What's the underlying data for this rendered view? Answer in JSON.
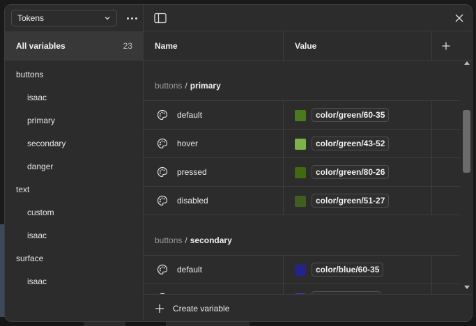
{
  "collection_select": {
    "value": "Tokens"
  },
  "sidebar": {
    "all_variables_label": "All variables",
    "all_variables_count": "23",
    "groups": [
      {
        "label": "buttons",
        "level": 0
      },
      {
        "label": "isaac",
        "level": 1
      },
      {
        "label": "primary",
        "level": 1
      },
      {
        "label": "secondary",
        "level": 1
      },
      {
        "label": "danger",
        "level": 1
      },
      {
        "label": "text",
        "level": 0
      },
      {
        "label": "custom",
        "level": 1
      },
      {
        "label": "isaac",
        "level": 1
      },
      {
        "label": "surface",
        "level": 0
      },
      {
        "label": "isaac",
        "level": 1
      }
    ]
  },
  "table": {
    "col_name": "Name",
    "col_value": "Value",
    "sections": [
      {
        "prefix": "buttons",
        "sep": "/",
        "name": "primary",
        "rows": [
          {
            "name": "default",
            "alias": "color/green/60-35",
            "swatch": "#4a7a1e"
          },
          {
            "name": "hover",
            "alias": "color/green/43-52",
            "swatch": "#7db24a"
          },
          {
            "name": "pressed",
            "alias": "color/green/80-26",
            "swatch": "#3f6a12"
          },
          {
            "name": "disabled",
            "alias": "color/green/51-27",
            "swatch": "#3e5e22"
          }
        ]
      },
      {
        "prefix": "buttons",
        "sep": "/",
        "name": "secondary",
        "rows": [
          {
            "name": "default",
            "alias": "color/blue/60-35",
            "swatch": "#23238a"
          },
          {
            "name": "",
            "alias": "",
            "swatch": "#3b3bb0"
          }
        ]
      }
    ]
  },
  "footer": {
    "create_label": "Create variable"
  }
}
